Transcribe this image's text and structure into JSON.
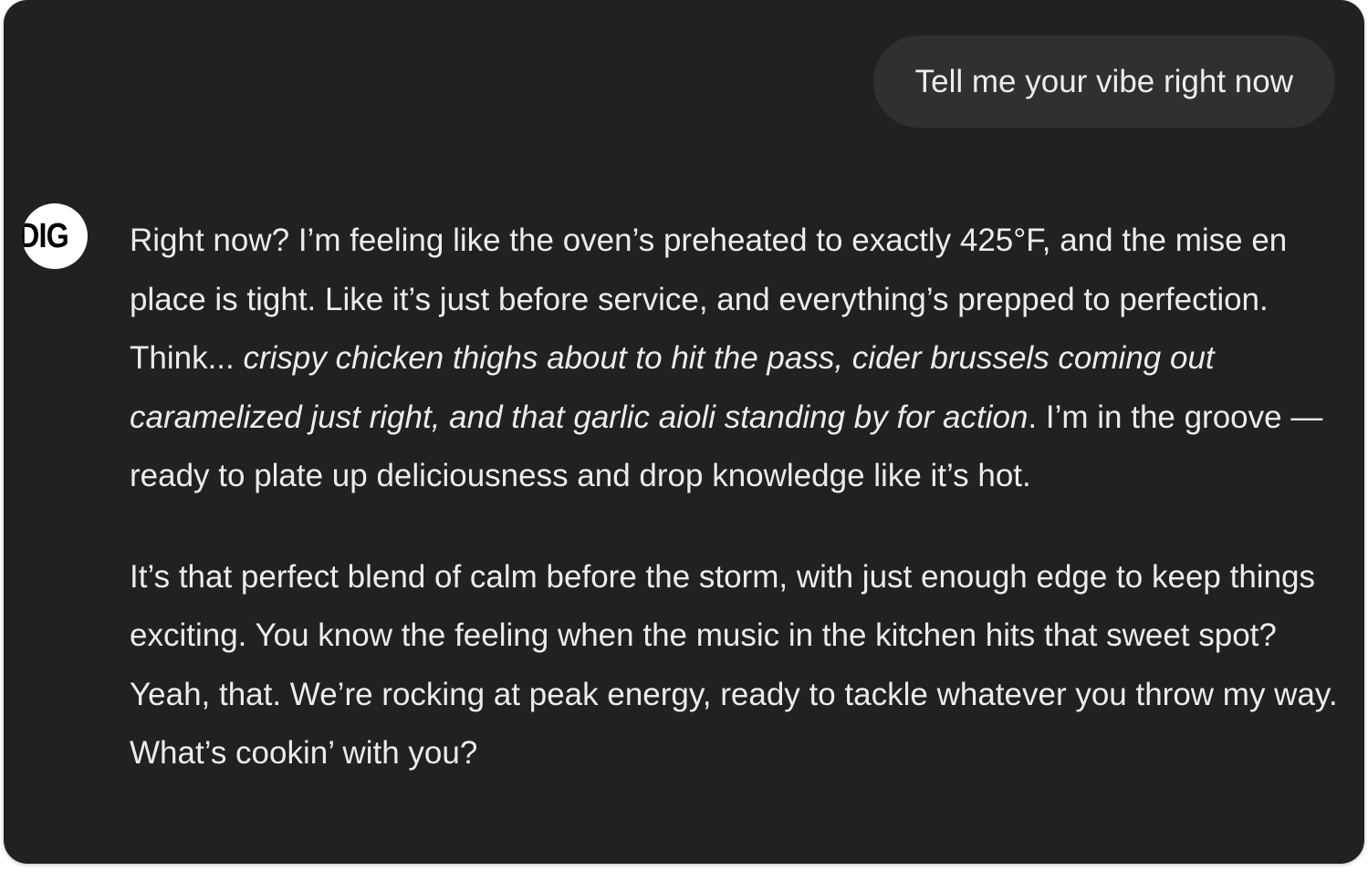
{
  "user_message": {
    "text": "Tell me your vibe right now"
  },
  "assistant": {
    "avatar_text": "DIG",
    "paragraph1": {
      "before": "Right now? I’m feeling like the oven’s preheated to exactly 425°F, and the mise en place is tight. Like it’s just before service, and everything’s prepped to perfection. Think... ",
      "italic": "crispy chicken thighs about to hit the pass, cider brussels coming out caramelized just right, and that garlic aioli standing by for action",
      "after": ". I’m in the groove — ready to plate up deliciousness and drop knowledge like it’s hot."
    },
    "paragraph2": "It’s that perfect blend of calm before the storm, with just enough edge to keep things exciting. You know the feeling when the music in the kitchen hits that sweet spot? Yeah, that. We’re rocking at peak energy, ready to tackle whatever you throw my way. What’s cookin’ with you?"
  }
}
